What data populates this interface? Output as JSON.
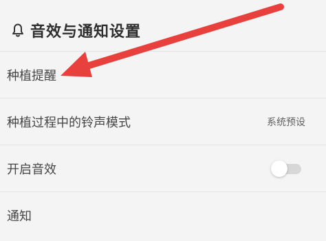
{
  "section": {
    "title": "音效与通知设置",
    "icon": "bell-icon"
  },
  "rows": [
    {
      "label": "种植提醒"
    },
    {
      "label": "种植过程中的铃声模式",
      "value": "系统预设"
    },
    {
      "label": "开启音效",
      "toggle_on": false
    },
    {
      "label": "通知"
    }
  ],
  "annotation": {
    "arrow_color": "#e8403d",
    "arrow_points_to": "种植提醒"
  }
}
